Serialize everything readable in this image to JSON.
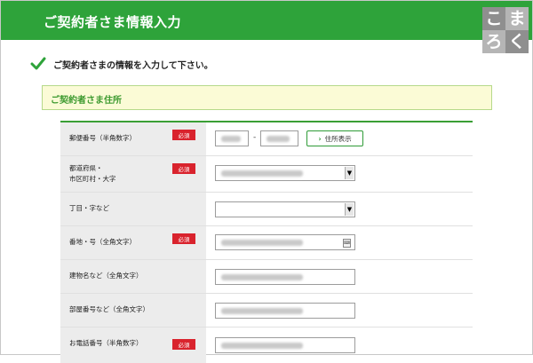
{
  "header": {
    "title": "ご契約者さま情報入力",
    "logo_chars": [
      "こ",
      "ま",
      "ろ",
      "く"
    ]
  },
  "instruction": "ご契約者さまの情報を入力して下さい。",
  "section": {
    "title": "ご契約者さま住所"
  },
  "required_label": "必須",
  "postal": {
    "separator": "-",
    "button_label": "住所表示"
  },
  "fields": [
    {
      "label": "郵便番号（半角数字）",
      "required": true
    },
    {
      "label_lines": [
        "都道府県・",
        "市区町村・大字"
      ],
      "required": true
    },
    {
      "label": "丁目・字など",
      "required": false
    },
    {
      "label": "番地・号（全角文字）",
      "required": true
    },
    {
      "label": "建物名など（全角文字）",
      "required": false
    },
    {
      "label": "部屋番号など（全角文字）",
      "required": false
    },
    {
      "label": "お電話番号（半角数字）",
      "required": true
    }
  ],
  "colors": {
    "header_green": "#2ea33a",
    "required_red": "#d9232d",
    "section_bg": "#fbfbd6",
    "section_title": "#3d9a2f"
  },
  "icons": {
    "check": "check-icon",
    "button_arrow": "chevron-right-icon",
    "select": "chevron-down-icon"
  }
}
